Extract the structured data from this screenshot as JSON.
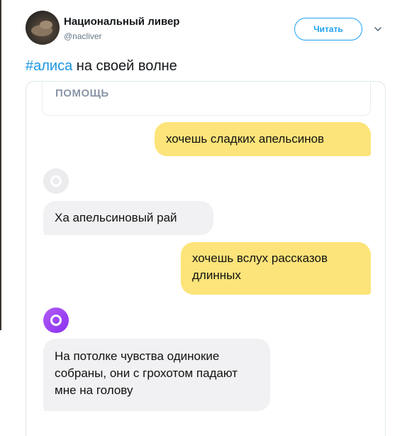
{
  "tweet": {
    "display_name": "Национальный ливер",
    "handle": "@nacliver",
    "follow_label": "Читать",
    "hashtag": "#алиса",
    "text_rest": " на своей волне"
  },
  "chat": {
    "help_label": "ПОМОЩЬ",
    "messages": [
      {
        "from": "user",
        "text": "хочешь сладких апельсинов"
      },
      {
        "from": "bot",
        "text": "Ха апельсиновый рай"
      },
      {
        "from": "user",
        "text": "хочешь вслух рассказов длинных"
      },
      {
        "from": "bot",
        "text": "На потолке чувства одинокие собраны, они с грохотом падают мне на голову"
      }
    ]
  },
  "colors": {
    "link": "#1b95e0",
    "follow": "#1da1f2",
    "user_bubble": "#fce47a",
    "bot_bubble": "#f1f1f3",
    "alice_purple": "#9b3ff2"
  },
  "icons": [
    "avatar",
    "chevron-down-icon",
    "alice-icon"
  ]
}
